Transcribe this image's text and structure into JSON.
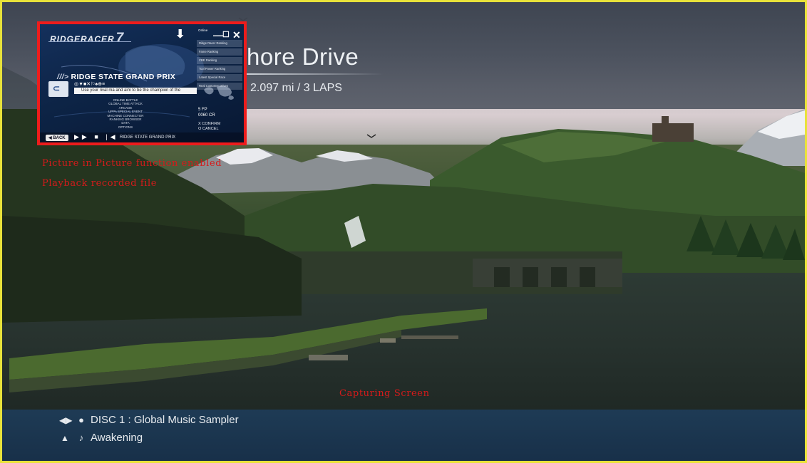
{
  "track": {
    "name_partial": "hore Drive",
    "distance": "2.097 mi / 3 LAPS"
  },
  "overlay": {
    "pip_enabled_label": "Picture in Picture function enabled",
    "playback_label": "Playback recorded file",
    "capturing_label": "Capturing Screen"
  },
  "music": {
    "disc_label": "DISC 1 : Global Music Sampler",
    "track_label": "Awakening"
  },
  "pip": {
    "logo_text": "RIDGERACER",
    "logo_number": "7",
    "heading": "RIDGE STATE GRAND PRIX",
    "tagline": "Use your rival ma and aim to be the champion of the",
    "menu_items": [
      "ONLINE BATTLE",
      "GLOBAL TIME ATTACK",
      "ARCADE",
      "UPPA SPECIAL EVENT",
      "MACHINE CONNECTOR",
      "RANKING BROWSER",
      "DATA",
      "OPTIONS"
    ],
    "rank_header": "Online",
    "rank_items": [
      "Ridge Racer Ranking",
      "Fame Ranking",
      "CBE Ranking",
      "Tool Power Ranking",
      "Latest Special Race",
      "Real Customer Drives"
    ],
    "fame_points": "5 FP",
    "credits": "0060 CR",
    "confirm_label": "X CONFIRM",
    "cancel_label": "O CANCEL",
    "back_label": "BACK",
    "status_text": "RIDGE STATE GRAND PRIX"
  },
  "colors": {
    "frame_border": "#e8e23a",
    "pip_border": "#ee1c1c",
    "overlay_text": "#d51b1b"
  }
}
